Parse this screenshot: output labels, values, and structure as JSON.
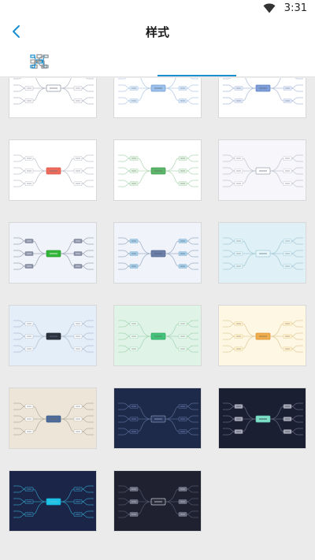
{
  "status": {
    "time": "3:31"
  },
  "header": {
    "title": "样式"
  },
  "tabs": [
    {
      "id": "tree-top",
      "icon": "org-chart-down-icon"
    },
    {
      "id": "tree-org",
      "icon": "org-chart-icon"
    },
    {
      "id": "mind-map",
      "icon": "mind-map-icon"
    },
    {
      "id": "logic",
      "icon": "logic-right-icon"
    }
  ],
  "active_tab": 2,
  "accent_color": "#1a8fcf",
  "styles": [
    {
      "bg": "#ffffff",
      "center": "#ffffff",
      "centerBorder": "#8a96a8",
      "node": "#ffffff",
      "nodeBorder": "#b6bcc6",
      "line": "#b7bdc6",
      "text": "#6f7782"
    },
    {
      "bg": "#ffffff",
      "center": "#9dc0ea",
      "centerBorder": "#6f9ed6",
      "node": "#dce9f8",
      "nodeBorder": "#a9c6ea",
      "line": "#b8cde6",
      "text": "#5a6c85"
    },
    {
      "bg": "#ffffff",
      "center": "#7f9ed8",
      "centerBorder": "#5e82c8",
      "node": "#e6ecf8",
      "nodeBorder": "#b3c4e6",
      "line": "#b3c0da",
      "text": "#5a6c85"
    },
    {
      "bg": "#ffffff",
      "center": "#ee6a5a",
      "centerBorder": "#d85444",
      "node": "#ffffff",
      "nodeBorder": "#c2c7cf",
      "line": "#c2c7cf",
      "text": "#6f7782"
    },
    {
      "bg": "#ffffff",
      "center": "#5cb66a",
      "centerBorder": "#3e9a4c",
      "node": "#eaf5ea",
      "nodeBorder": "#a9d5ae",
      "line": "#b5d9b9",
      "text": "#5e7a62"
    },
    {
      "bg": "#f7f7fb",
      "center": "#ffffff",
      "centerBorder": "#9aa3b0",
      "node": "#ffffff",
      "nodeBorder": "#c9cdd6",
      "line": "#c4c8d0",
      "text": "#6f7782"
    },
    {
      "bg": "#f1f3fa",
      "center": "#33b53b",
      "centerBorder": "#259a2d",
      "node": "#8c93a8",
      "nodeBorder": "#7a8297",
      "line": "#a3a9ba",
      "text": "#ffffff"
    },
    {
      "bg": "#f1f3fa",
      "center": "#6b7fa8",
      "centerBorder": "#58698e",
      "node": "#a8cfe8",
      "nodeBorder": "#88b6d6",
      "line": "#9fb2c8",
      "text": "#4f5d74"
    },
    {
      "bg": "#dff0f6",
      "center": "#e8f6fa",
      "centerBorder": "#9ec8d8",
      "node": "#e8f6fa",
      "nodeBorder": "#a9d0de",
      "line": "#a9ccd8",
      "text": "#5d7c88"
    },
    {
      "bg": "#e4eef8",
      "center": "#2c3440",
      "centerBorder": "#1e242c",
      "node": "#ffffff",
      "nodeBorder": "#b8c6d6",
      "line": "#b3c1d2",
      "text": "#5a6c85"
    },
    {
      "bg": "#dff3e6",
      "center": "#43c27a",
      "centerBorder": "#2ea663",
      "node": "#f1faf4",
      "nodeBorder": "#a7dbb9",
      "line": "#a9d7b8",
      "text": "#5a7a65"
    },
    {
      "bg": "#fdf7e4",
      "center": "#f0ad4e",
      "centerBorder": "#d99232",
      "node": "#fff3d6",
      "nodeBorder": "#ecd39a",
      "line": "#e2cf9f",
      "text": "#857450"
    },
    {
      "bg": "#ece5d8",
      "center": "#4d6c9c",
      "centerBorder": "#3c5a88",
      "node": "#ffffff",
      "nodeBorder": "#c9c0ae",
      "line": "#b9b2a4",
      "text": "#6f6a60"
    },
    {
      "bg": "#1e2a4a",
      "center": "#2c3a60",
      "centerBorder": "#7f8db0",
      "node": "#24315a",
      "nodeBorder": "#5d6b94",
      "line": "#55648f",
      "text": "#9aa6c6"
    },
    {
      "bg": "#1b1f32",
      "center": "#7fe0c8",
      "centerBorder": "#5dc7ad",
      "node": "#a6aab8",
      "nodeBorder": "#8c91a2",
      "line": "#5c6178",
      "text": "#2a2e40"
    },
    {
      "bg": "#1b2548",
      "center": "#1ec3e8",
      "centerBorder": "#12a6cc",
      "node": "#1e2b52",
      "nodeBorder": "#2f9fc2",
      "line": "#2f8fb4",
      "text": "#5fc3e0"
    },
    {
      "bg": "#1f2130",
      "center": "#2a2c3c",
      "centerBorder": "#c9ccd6",
      "node": "#6a6e80",
      "nodeBorder": "#83879a",
      "line": "#4e5266",
      "text": "#d4d6de"
    }
  ]
}
